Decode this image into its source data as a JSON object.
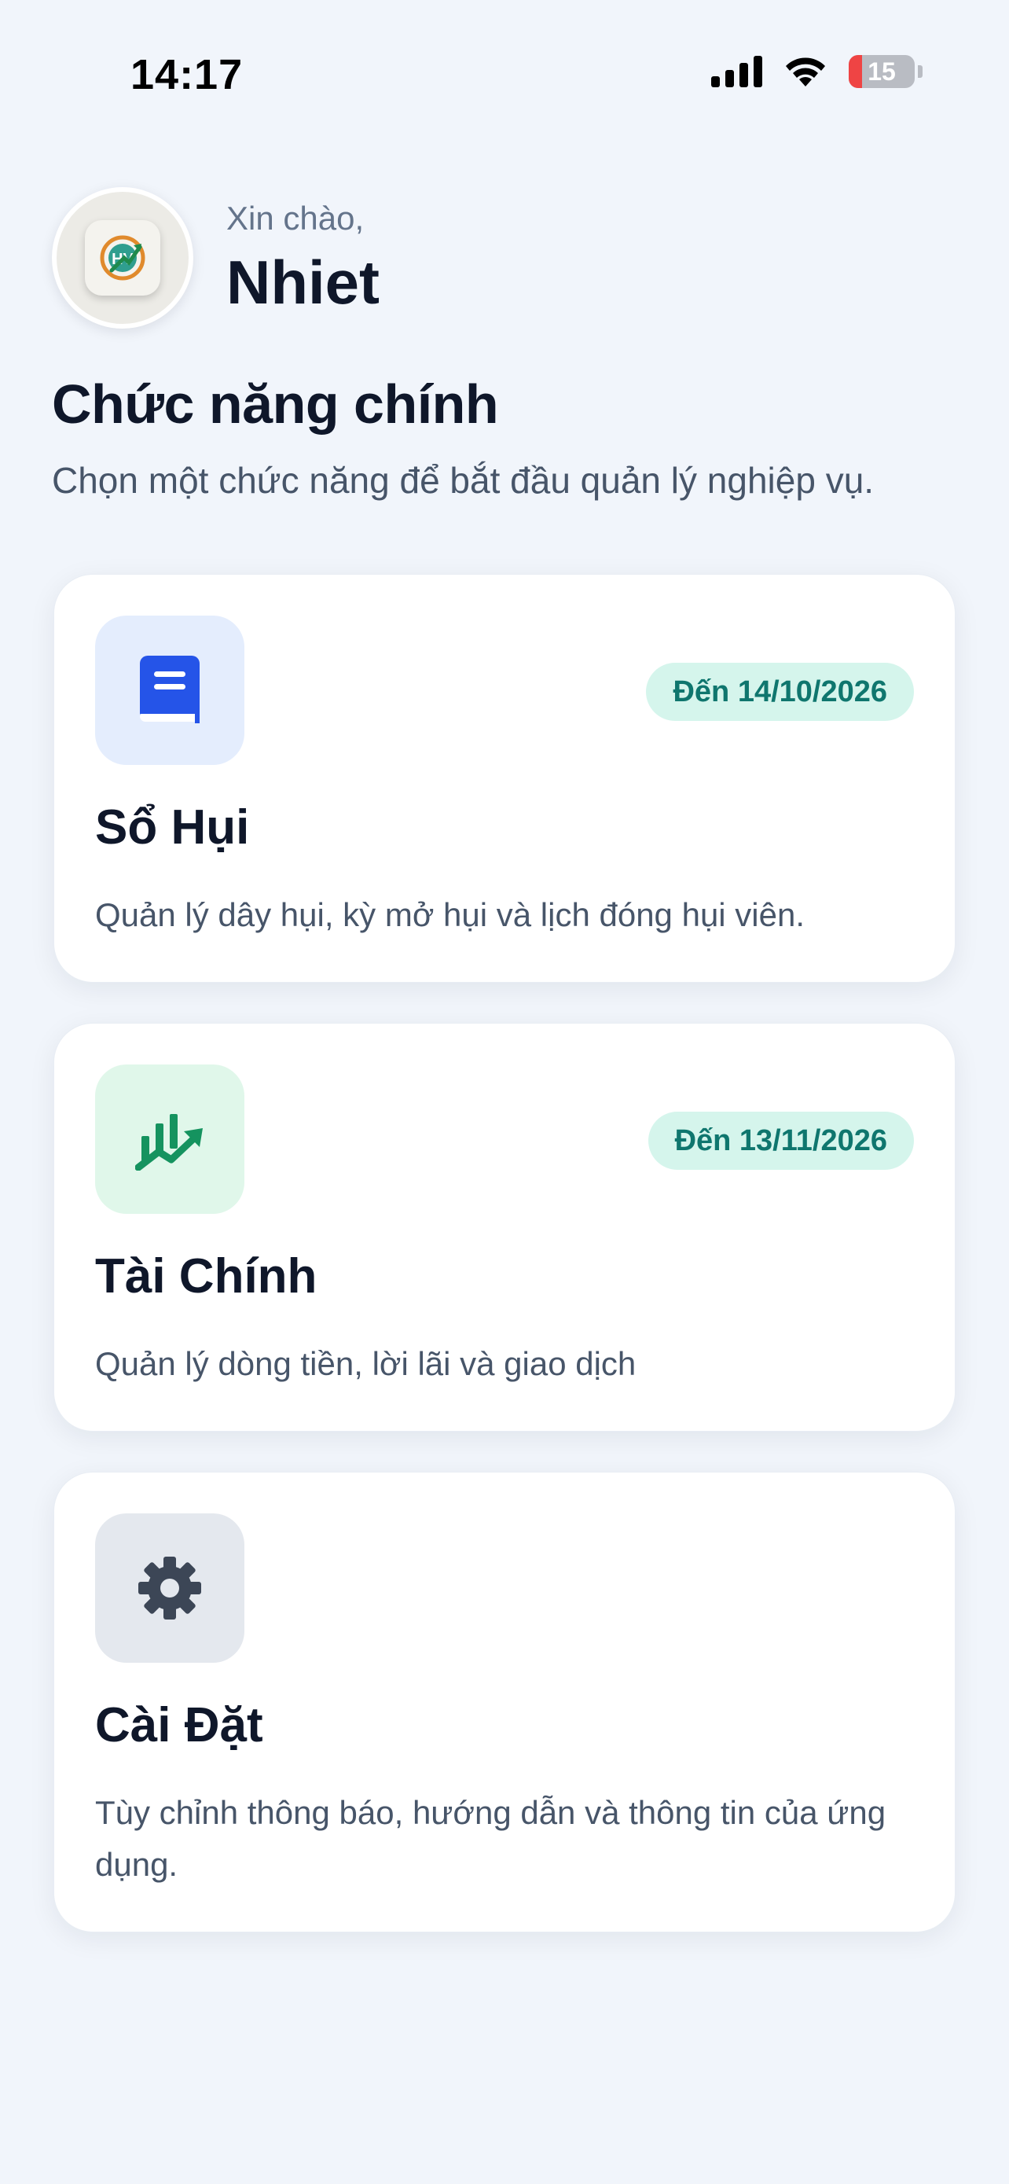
{
  "status_bar": {
    "time": "14:17",
    "battery_level": "15",
    "icons": [
      "signal-icon",
      "wifi-icon",
      "battery-icon"
    ]
  },
  "header": {
    "greeting": "Xin chào,",
    "name": "Nhiet",
    "avatar_icon": "app-logo-icon"
  },
  "section": {
    "title": "Chức năng chính",
    "subtitle": "Chọn một chức năng để bắt đầu quản lý nghiệp vụ."
  },
  "cards": [
    {
      "title": "Sổ Hụi",
      "badge": "Đến 14/10/2026",
      "description": "Quản lý dây hụi, kỳ mở hụi và lịch đóng hụi viên.",
      "icon": "book-icon",
      "icon_color": "#2554e8",
      "icon_bg": "#e4edfd"
    },
    {
      "title": "Tài Chính",
      "badge": "Đến 13/11/2026",
      "description": "Quản lý dòng tiền, lời lãi và giao dịch",
      "icon": "chart-growth-icon",
      "icon_color": "#15935f",
      "icon_bg": "#e0f7ea"
    },
    {
      "title": "Cài Đặt",
      "description": "Tùy chỉnh thông báo, hướng dẫn và thông tin của ứng dụng.",
      "icon": "gear-icon",
      "icon_color": "#3c4656",
      "icon_bg": "#e4e8ee"
    }
  ],
  "colors": {
    "background": "#f1f5fb",
    "badge_bg": "#d5f5ec",
    "badge_text": "#0f766e"
  }
}
